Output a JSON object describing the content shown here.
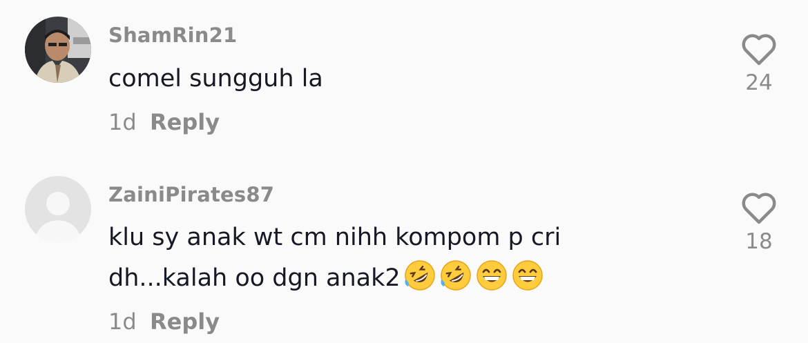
{
  "comments": [
    {
      "username": "ShamRin21",
      "lines": [
        "comel sungguh la"
      ],
      "time": "1d",
      "reply_label": "Reply",
      "likes": "24",
      "avatar": "photo"
    },
    {
      "username": "ZainiPirates87",
      "lines": [
        "klu sy anak wt cm nihh kompom p cri",
        "dh...kalah oo dgn anak2"
      ],
      "emojis": [
        "rolling-on-floor-laughing",
        "rolling-on-floor-laughing",
        "grinning-face-with-smiling-eyes",
        "grinning-face-with-smiling-eyes"
      ],
      "time": "1d",
      "reply_label": "Reply",
      "likes": "18",
      "avatar": "default-placeholder"
    }
  ],
  "icons": {
    "like": "heart-outline-icon"
  },
  "colors": {
    "text": "#161823",
    "muted": "#8a8a8a",
    "background": "#fafafa"
  }
}
